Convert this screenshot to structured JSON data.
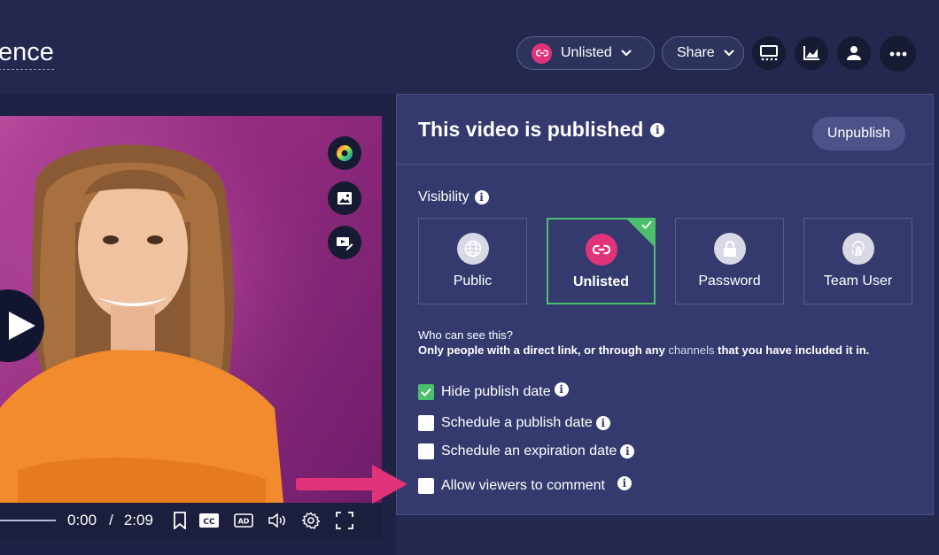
{
  "header": {
    "title_fragment": "ence",
    "visibility_pill_label": "Unlisted",
    "share_label": "Share",
    "icons": [
      "link-icon",
      "chevron-down-icon",
      "slides-icon",
      "analytics-icon",
      "user-icon",
      "more-icon"
    ]
  },
  "player": {
    "current_time": "0:00",
    "separator": "/",
    "duration": "2:09",
    "controls": [
      "bookmark-icon",
      "cc-icon",
      "ad-icon",
      "volume-icon",
      "settings-icon",
      "fullscreen-icon"
    ],
    "side_tools": [
      "color-wheel-icon",
      "image-icon",
      "edit-cover-icon"
    ]
  },
  "panel": {
    "title": "This video is published",
    "unpublish_label": "Unpublish",
    "visibility_label": "Visibility",
    "options": [
      {
        "label": "Public",
        "icon": "globe-icon",
        "selected": false
      },
      {
        "label": "Unlisted",
        "icon": "link-icon",
        "selected": true
      },
      {
        "label": "Password",
        "icon": "lock-icon",
        "selected": false
      },
      {
        "label": "Team User",
        "icon": "fingerprint-icon",
        "selected": false
      }
    ],
    "who_question": "Who can see this?",
    "who_answer_part1": "Only people with a direct link, or through any",
    "who_answer_channels": "channels",
    "who_answer_part2": "that you have included it in.",
    "checkboxes": [
      {
        "label": "Hide publish date",
        "checked": true
      },
      {
        "label": "Schedule a publish date",
        "checked": false
      },
      {
        "label": "Schedule an expiration date",
        "checked": false
      },
      {
        "label": "Allow viewers to comment",
        "checked": false
      }
    ]
  },
  "colors": {
    "accent_pink": "#e0337a",
    "selected_green": "#4bbf6b",
    "panel_bg": "#343a6e",
    "page_bg": "#24284f",
    "arrow": "#e0337a"
  }
}
